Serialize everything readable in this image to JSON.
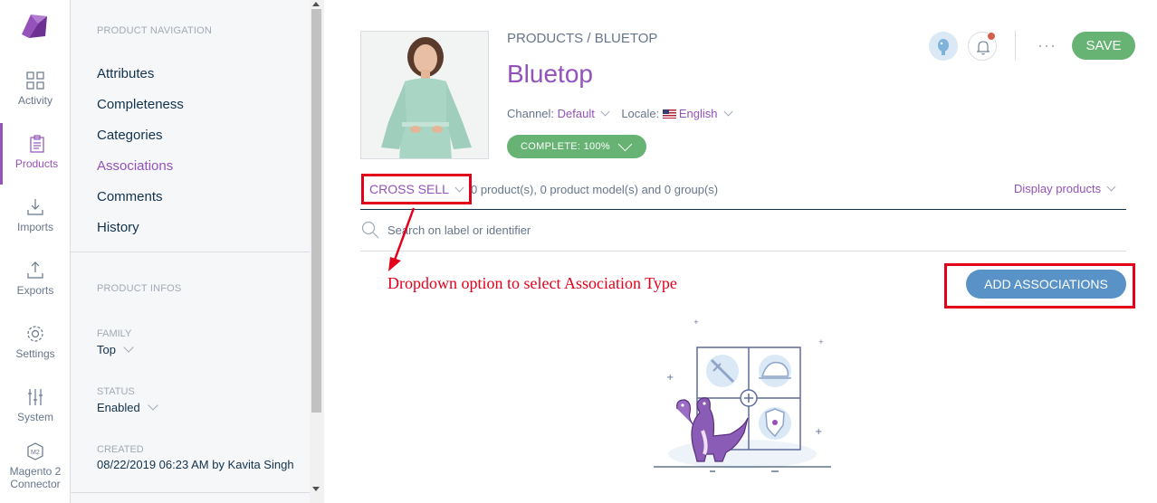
{
  "main_menu": {
    "items": [
      {
        "label": "Activity",
        "icon": "dashboard-icon"
      },
      {
        "label": "Products",
        "icon": "clipboard-icon",
        "active": true
      },
      {
        "label": "Imports",
        "icon": "import-icon"
      },
      {
        "label": "Exports",
        "icon": "export-icon"
      },
      {
        "label": "Settings",
        "icon": "gear-icon"
      },
      {
        "label": "System",
        "icon": "sliders-icon"
      },
      {
        "label": "Magento 2 Connector",
        "icon": "m2-icon"
      }
    ],
    "accent_color": "#9452ba"
  },
  "column_nav": {
    "nav_title": "PRODUCT NAVIGATION",
    "links": [
      "Attributes",
      "Completeness",
      "Categories",
      "Associations",
      "Comments",
      "History"
    ],
    "active_link": "Associations",
    "infos_title": "PRODUCT INFOS",
    "family": {
      "label": "FAMILY",
      "value": "Top"
    },
    "status": {
      "label": "STATUS",
      "value": "Enabled"
    },
    "created": {
      "label": "CREATED",
      "value": "08/22/2019 06:23 AM by Kavita Singh"
    }
  },
  "header": {
    "breadcrumb_root": "PRODUCTS",
    "breadcrumb_sep": "/",
    "breadcrumb_current": "BLUETOP",
    "title": "Bluetop",
    "channel_label": "Channel:",
    "channel_value": "Default",
    "locale_label": "Locale:",
    "locale_value": "English",
    "complete_badge": "COMPLETE: 100%",
    "save_label": "SAVE",
    "more_label": "···"
  },
  "associations": {
    "type_label": "CROSS SELL",
    "counts": "0 product(s), 0 product model(s) and 0 group(s)",
    "display_label": "Display products",
    "search_placeholder": "Search on label or identifier",
    "add_button": "ADD ASSOCIATIONS",
    "annotation": "Dropdown option to select Association Type"
  },
  "colors": {
    "purple": "#9452ba",
    "green": "#67b373",
    "blue_button": "#5992c7",
    "annotation_red": "#e3001b"
  }
}
